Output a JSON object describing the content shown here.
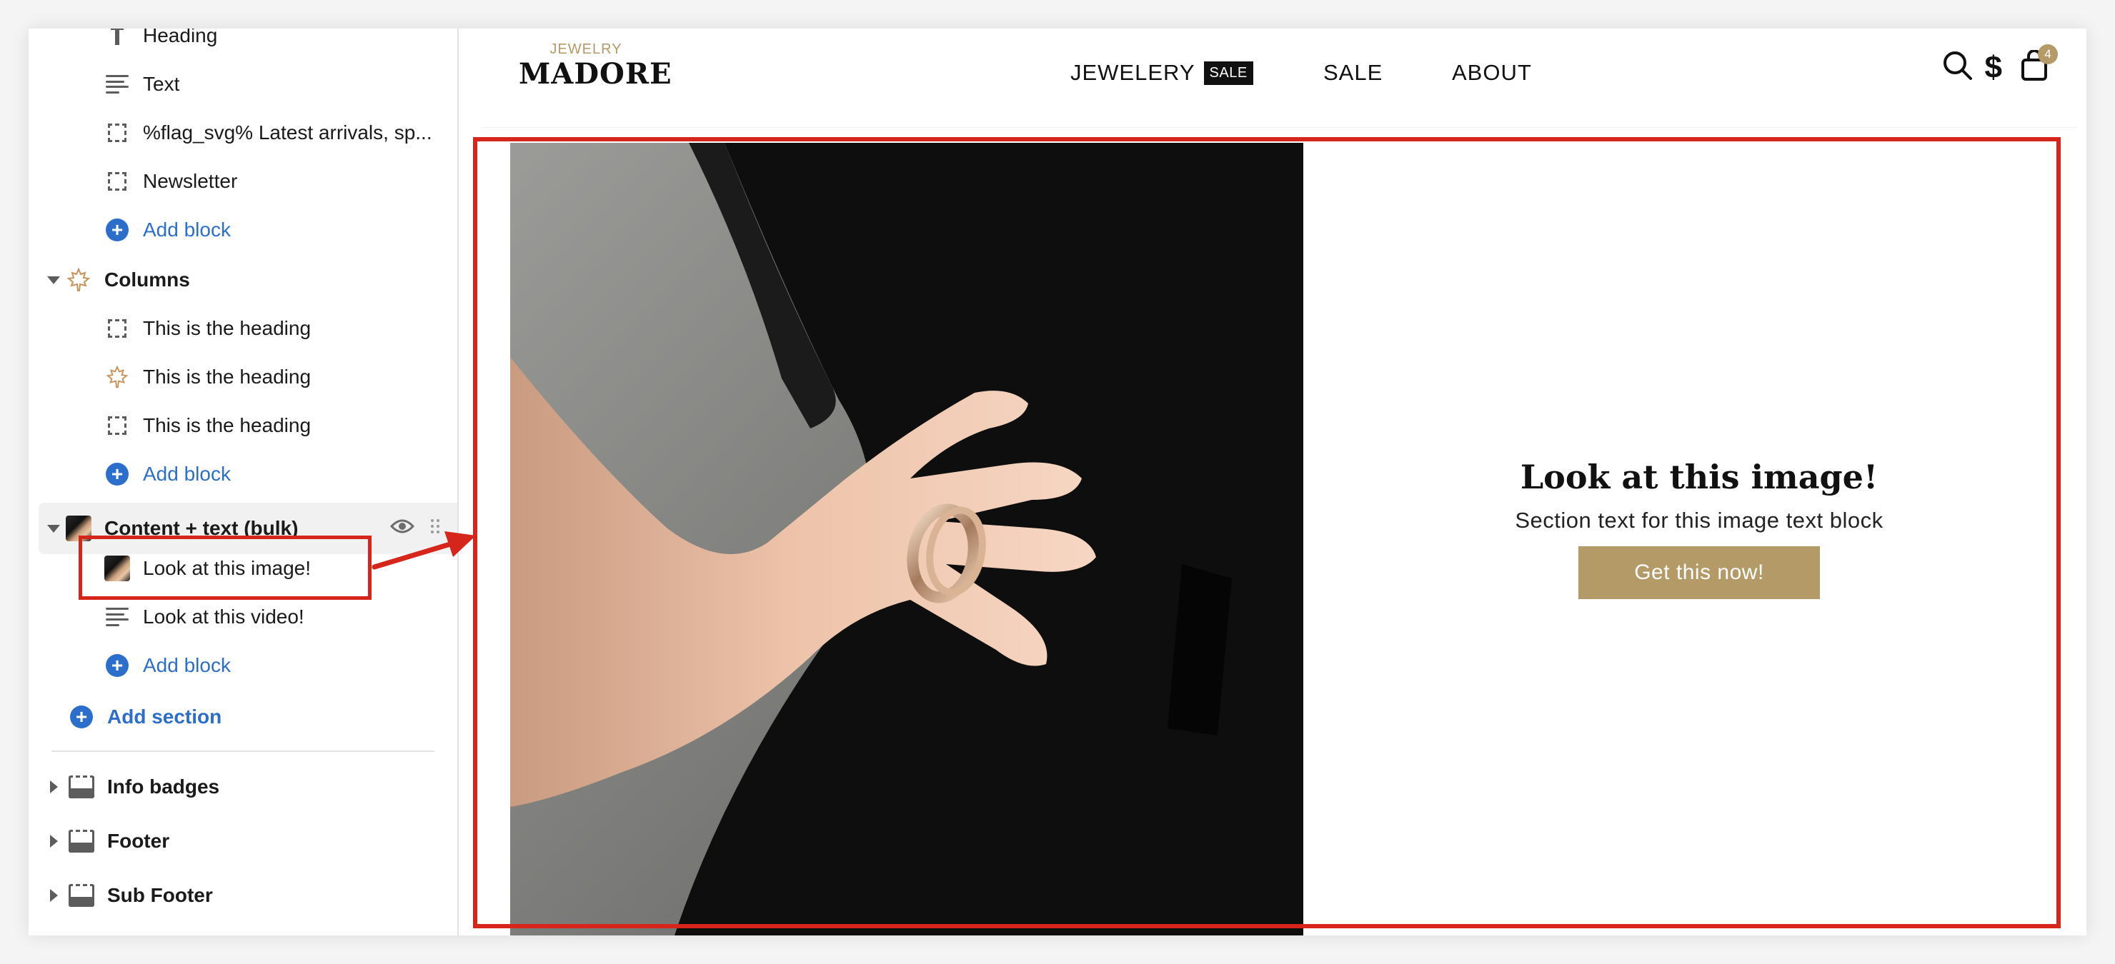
{
  "sidebar": {
    "blocks_top": [
      {
        "icon": "heading-icon",
        "label": "Heading"
      },
      {
        "icon": "text-lines-icon",
        "label": "Text"
      },
      {
        "icon": "dashed-block-icon",
        "label": "%flag_svg% Latest arrivals, sp..."
      },
      {
        "icon": "dashed-block-icon",
        "label": "Newsletter"
      }
    ],
    "add_block_label": "Add block",
    "columns": {
      "label": "Columns",
      "items": [
        {
          "icon": "dashed-block-icon",
          "label": "This is the heading"
        },
        {
          "icon": "maple-leaf-icon",
          "label": "This is the heading"
        },
        {
          "icon": "dashed-block-icon",
          "label": "This is the heading"
        }
      ]
    },
    "content_text": {
      "label": "Content + text (bulk)",
      "items": [
        {
          "icon": "image-thumbnail-icon",
          "label": "Look at this image!"
        },
        {
          "icon": "text-lines-icon",
          "label": "Look at this video!"
        }
      ]
    },
    "add_section_label": "Add section",
    "sections": [
      {
        "label": "Info badges"
      },
      {
        "label": "Footer"
      },
      {
        "label": "Sub Footer"
      }
    ]
  },
  "store": {
    "logo_small": "JEWELRY",
    "logo_main": "MADORE",
    "nav": [
      {
        "label": "JEWELERY",
        "badge": "SALE"
      },
      {
        "label": "SALE"
      },
      {
        "label": "ABOUT"
      }
    ],
    "cart_count": "4",
    "hero": {
      "title": "Look at this image!",
      "subtitle": "Section text for this image text block",
      "button": "Get this now!"
    }
  },
  "colors": {
    "accent_gold": "#b39a66",
    "highlight_red": "#d6251b",
    "link_blue": "#2c6ecb"
  }
}
